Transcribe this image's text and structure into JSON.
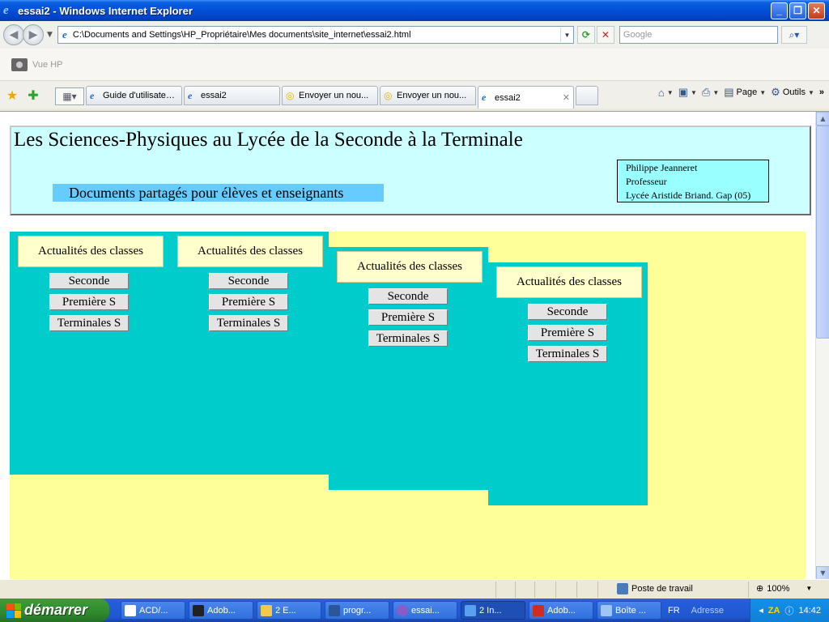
{
  "window": {
    "title": "essai2 - Windows Internet Explorer",
    "minimize": "_",
    "maximize": "❐",
    "close": "✕"
  },
  "address_bar": {
    "url": "C:\\Documents and Settings\\HP_Propriétaire\\Mes documents\\site_internet\\essai2.html",
    "search_placeholder": "Google"
  },
  "links_bar": {
    "label": "Vue HP"
  },
  "tabs": [
    {
      "label": "Guide d'utilisateu...",
      "icon": "ie-icon",
      "active": false
    },
    {
      "label": "essai2",
      "icon": "ie-icon",
      "active": false
    },
    {
      "label": "Envoyer un nou...",
      "icon": "warning-icon",
      "active": false
    },
    {
      "label": "Envoyer un nou...",
      "icon": "warning-icon",
      "active": false
    },
    {
      "label": "essai2",
      "icon": "ie-icon",
      "active": true
    }
  ],
  "command_bar": {
    "page": "Page",
    "tools": "Outils"
  },
  "page": {
    "title": "Les Sciences-Physiques au Lycée de la Seconde à la Terminale",
    "subtitle": "Documents partagés pour élèves et enseignants",
    "author_lines": [
      "Philippe Jeanneret",
      "Professeur",
      "Lycée Aristide Briand. Gap (05)"
    ],
    "columns": [
      {
        "card": "Actualités des classes",
        "buttons": [
          "Seconde",
          "Première S",
          "Terminales S"
        ]
      },
      {
        "card": "Actualités des classes",
        "buttons": [
          "Seconde",
          "Première S",
          "Terminales S"
        ]
      },
      {
        "card": "Actualités des classes",
        "buttons": [
          "Seconde",
          "Première S",
          "Terminales S"
        ]
      },
      {
        "card": "Actualités des classes",
        "buttons": [
          "Seconde",
          "Première S",
          "Terminales S"
        ]
      }
    ],
    "colors": {
      "header_bg": "#ccffff",
      "subtitle_bg": "#66ccff",
      "content_bg": "#ffff99",
      "column_bg": "#00cccc",
      "card_bg": "#ffffcc"
    }
  },
  "status_bar": {
    "zone": "Poste de travail",
    "zoom": "100%"
  },
  "taskbar": {
    "start": "démarrer",
    "items": [
      {
        "label": "ACD/...",
        "active": false
      },
      {
        "label": "Adob...",
        "active": false
      },
      {
        "label": "2 E...",
        "active": false
      },
      {
        "label": "progr...",
        "active": false
      },
      {
        "label": "essai...",
        "active": false
      },
      {
        "label": "2 In...",
        "active": true
      },
      {
        "label": "Adob...",
        "active": false
      },
      {
        "label": "Boîte ...",
        "active": false
      }
    ],
    "lang": "FR",
    "address_label": "Adresse",
    "clock": "14:42"
  }
}
